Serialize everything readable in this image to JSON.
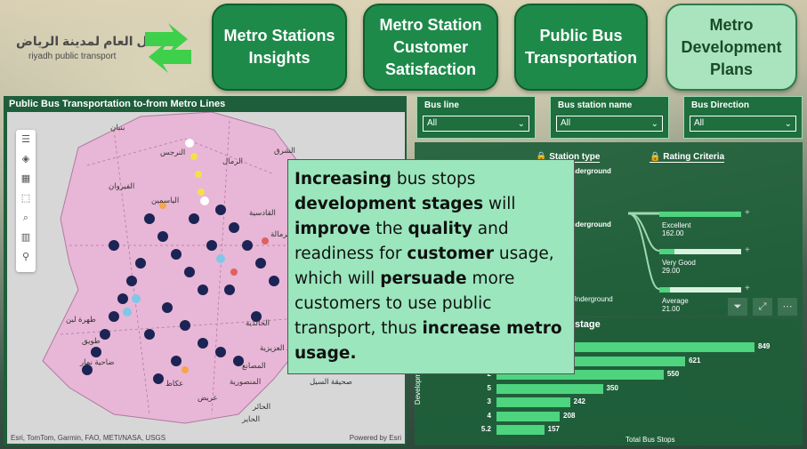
{
  "logo": {
    "arabic": "النقل العام لمدينة الرياض",
    "english": "riyadh public transport"
  },
  "nav": [
    {
      "label": "Metro Stations Insights",
      "active": false
    },
    {
      "label": "Metro Station Customer Satisfaction",
      "active": false
    },
    {
      "label": "Public Bus Transportation",
      "active": false
    },
    {
      "label": "Metro Development Plans",
      "active": true
    }
  ],
  "map": {
    "title": "Public Bus Transportation to-from Metro Lines",
    "attribution": "Esri, TomTom, Garmin, FAO, METI/NASA, USGS",
    "powered": "Powered by Esri",
    "places": [
      "بنبان",
      "الشرق",
      "الرمال",
      "الفيروان",
      "النرجس",
      "الياسمين",
      "القادسية",
      "ظهرة لبن",
      "طويق",
      "ضاحية نمار",
      "عكاظ",
      "عريض",
      "المنصورية",
      "الخالدية",
      "الحائر",
      "الحاير",
      "المصانع",
      "صحيقة السيل",
      "الرمالة",
      "حي العزيزية"
    ]
  },
  "slicers": [
    {
      "label": "Bus line",
      "value": "All"
    },
    {
      "label": "Bus station name",
      "value": "All"
    },
    {
      "label": "Bus Direction",
      "value": "All"
    }
  ],
  "decomp": {
    "tab1": "Station type",
    "tab2": "Rating Criteria",
    "col1_top": "nderground",
    "col1_mid": "nderground",
    "col1_d": "d",
    "col1_bottom": "Underground",
    "ratings": [
      {
        "label": "Excellent",
        "value": "162.00",
        "fraction": 1.0
      },
      {
        "label": "Very Good",
        "value": "29.00",
        "fraction": 0.18
      },
      {
        "label": "Average",
        "value": "21.00",
        "fraction": 0.13
      }
    ]
  },
  "callout": {
    "segments": [
      {
        "t": "Increasing",
        "b": true
      },
      {
        "t": " bus stops ",
        "b": false
      },
      {
        "t": "development stages",
        "b": true
      },
      {
        "t": " will ",
        "b": false
      },
      {
        "t": "improve",
        "b": true
      },
      {
        "t": " the ",
        "b": false
      },
      {
        "t": "quality",
        "b": true
      },
      {
        "t": " and readiness for ",
        "b": false
      },
      {
        "t": "customer",
        "b": true
      },
      {
        "t": " usage, which will ",
        "b": false
      },
      {
        "t": "persuade",
        "b": true
      },
      {
        "t": " more customers to use public transport, thus ",
        "b": false
      },
      {
        "t": "increase metro usage.",
        "b": true
      }
    ]
  },
  "chart_data": {
    "type": "bar",
    "title": "stage",
    "ylabel": "Development",
    "xlabel": "Total Bus Stops",
    "categories": [
      "",
      "",
      "2",
      "5",
      "3",
      "4",
      "5.2"
    ],
    "values": [
      849,
      621,
      550,
      350,
      242,
      208,
      157
    ],
    "xlim": [
      0,
      849
    ]
  },
  "colors": {
    "nav_green": "#1e8a4a",
    "nav_active": "#a9e4bf",
    "panel_green": "#1e5e3a",
    "bar_green": "#4ed37e",
    "callout_bg": "#9be6bd",
    "map_pink": "#e8b6d6"
  }
}
